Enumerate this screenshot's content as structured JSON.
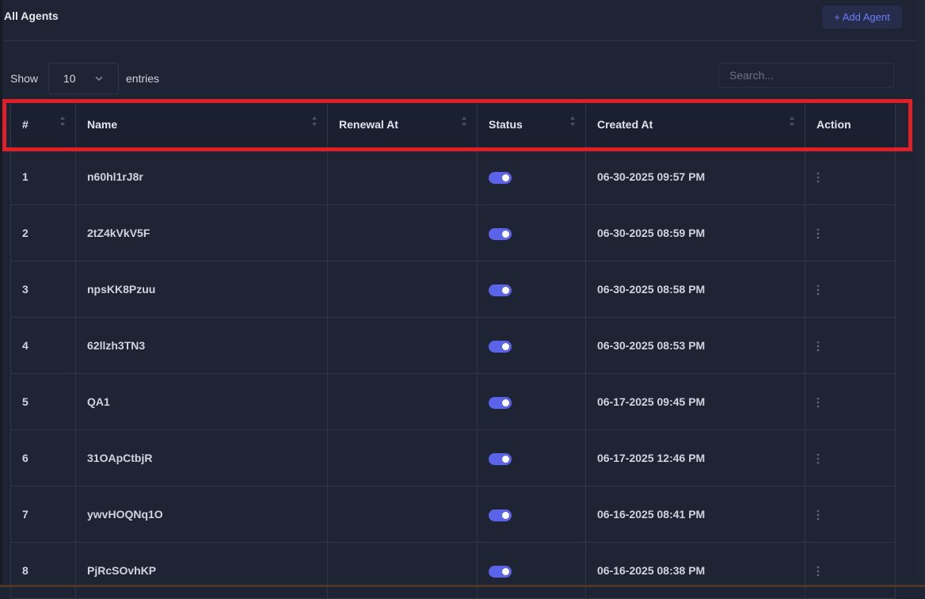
{
  "header": {
    "title": "All Agents",
    "add_button_label": "+ Add Agent"
  },
  "controls": {
    "show_label": "Show",
    "page_size": "10",
    "entries_label": "entries",
    "search_placeholder": "Search..."
  },
  "table": {
    "columns": [
      "#",
      "Name",
      "Renewal At",
      "Status",
      "Created At",
      "Action"
    ],
    "rows": [
      {
        "num": "1",
        "name": "n60hl1rJ8r",
        "renewal": "",
        "status_on": true,
        "created": "06-30-2025 09:57 PM"
      },
      {
        "num": "2",
        "name": "2tZ4kVkV5F",
        "renewal": "",
        "status_on": true,
        "created": "06-30-2025 08:59 PM"
      },
      {
        "num": "3",
        "name": "npsKK8Pzuu",
        "renewal": "",
        "status_on": true,
        "created": "06-30-2025 08:58 PM"
      },
      {
        "num": "4",
        "name": "62llzh3TN3",
        "renewal": "",
        "status_on": true,
        "created": "06-30-2025 08:53 PM"
      },
      {
        "num": "5",
        "name": "QA1",
        "renewal": "",
        "status_on": true,
        "created": "06-17-2025 09:45 PM"
      },
      {
        "num": "6",
        "name": "31OApCtbjR",
        "renewal": "",
        "status_on": true,
        "created": "06-17-2025 12:46 PM"
      },
      {
        "num": "7",
        "name": "ywvHOQNq1O",
        "renewal": "",
        "status_on": true,
        "created": "06-16-2025 08:41 PM"
      },
      {
        "num": "8",
        "name": "PjRcSOvhKP",
        "renewal": "",
        "status_on": true,
        "created": "06-16-2025 08:38 PM"
      }
    ]
  },
  "colors": {
    "background": "#1e2433",
    "accent": "#5b63e8",
    "highlight": "#e01f26"
  },
  "icons": {
    "sort": "sort-arrows-icon",
    "action": "kebab-menu-icon",
    "dropdown": "chevron-down-icon"
  }
}
